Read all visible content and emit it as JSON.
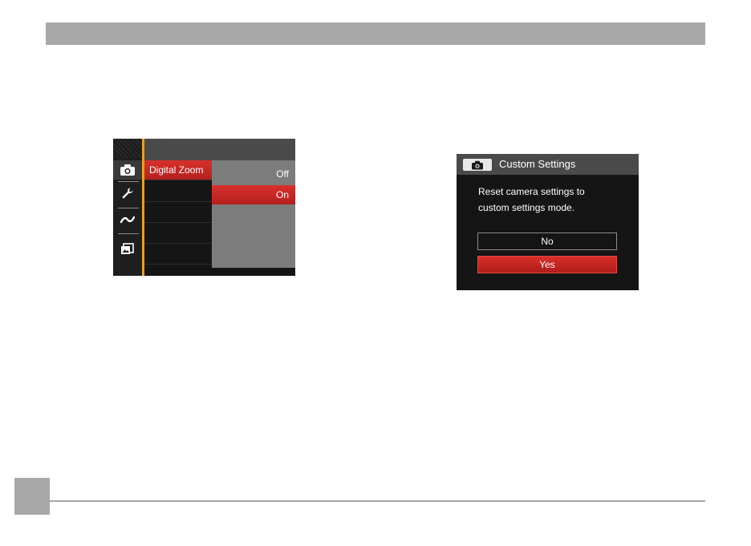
{
  "camera_menu": {
    "selected_item": "Digital Zoom",
    "options": [
      "Off",
      "On"
    ],
    "selected_option": "On",
    "icons": [
      "camera-icon",
      "wrench-icon",
      "connection-icon",
      "playback-icon"
    ],
    "colors": {
      "highlight": "#c8281f",
      "accent_line": "#e8a11c"
    }
  },
  "dialog": {
    "icon": "camera-icon",
    "title": "Custom Settings",
    "message_line1": "Reset camera settings to",
    "message_line2": "custom settings mode.",
    "no_label": "No",
    "yes_label": "Yes",
    "selected": "Yes"
  }
}
